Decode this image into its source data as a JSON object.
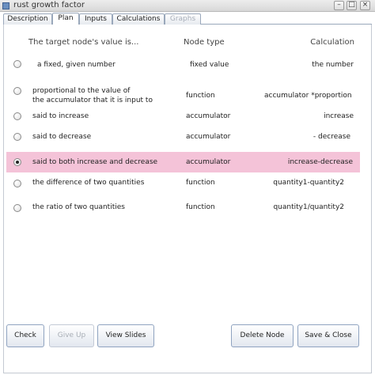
{
  "window": {
    "title": "rust growth factor",
    "controls": {
      "minimize": "–",
      "maximize": "□",
      "close": "×"
    }
  },
  "tabs": [
    {
      "label": "Description",
      "state": "normal"
    },
    {
      "label": "Plan",
      "state": "selected"
    },
    {
      "label": "Inputs",
      "state": "normal"
    },
    {
      "label": "Calculations",
      "state": "normal"
    },
    {
      "label": "Graphs",
      "state": "disabled"
    }
  ],
  "table": {
    "headers": {
      "description": "The target node's value is...",
      "node_type": "Node type",
      "calculation": "Calculation"
    },
    "rows": [
      {
        "description": "a fixed, given number",
        "node_type": "fixed value",
        "calculation": "the number",
        "selected": false
      },
      {
        "description": "proportional to the value of",
        "description_line2": "the accumulator that it is input to",
        "node_type": "function",
        "calculation": "accumulator *proportion",
        "selected": false
      },
      {
        "description": "said to increase",
        "node_type": "accumulator",
        "calculation": "increase",
        "selected": false
      },
      {
        "description": "said to decrease",
        "node_type": "accumulator",
        "calculation": "- decrease",
        "selected": false
      },
      {
        "description": "said to both increase and decrease",
        "node_type": "accumulator",
        "calculation": "increase-decrease",
        "selected": true
      },
      {
        "description": "the difference of two quantities",
        "node_type": "function",
        "calculation": "quantity1-quantity2",
        "selected": false
      },
      {
        "description": "the ratio of two quantities",
        "node_type": "function",
        "calculation": "quantity1/quantity2",
        "selected": false
      }
    ]
  },
  "buttons": {
    "check": "Check",
    "give_up": "Give Up",
    "view_slides": "View Slides",
    "delete_node": "Delete Node",
    "save_close": "Save & Close"
  },
  "colors": {
    "selected_row": "#f4c3d8",
    "tab_border": "#9aa8bb",
    "disabled_text": "#a6adb8"
  }
}
